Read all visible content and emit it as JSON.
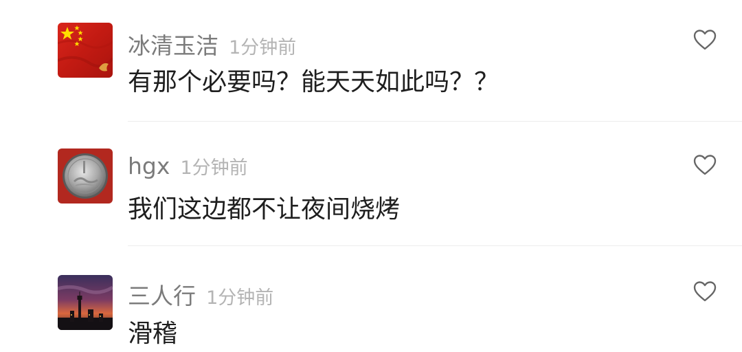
{
  "comments": [
    {
      "username": "冰清玉洁",
      "time": "1分钟前",
      "text": "有那个必要吗？能天天如此吗？？",
      "avatar_icon": "china-flag-avatar"
    },
    {
      "username": "hgx",
      "time": "1分钟前",
      "text": "我们这边都不让夜间烧烤",
      "avatar_icon": "coin-avatar"
    },
    {
      "username": "三人行",
      "time": "1分钟前",
      "text": "滑稽",
      "avatar_icon": "city-sunset-avatar"
    }
  ],
  "like_icon": "heart-outline-icon",
  "colors": {
    "username": "#7b7b7b",
    "timestamp": "#b4b4b4",
    "text": "#1e1e1e",
    "divider": "#ececec"
  }
}
